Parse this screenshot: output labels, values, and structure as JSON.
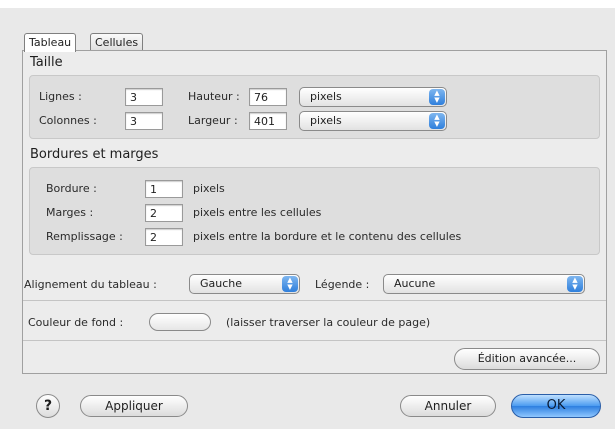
{
  "tabs": [
    {
      "label": "Tableau",
      "active": true
    },
    {
      "label": "Cellules",
      "active": false
    }
  ],
  "size_section": {
    "title": "Taille",
    "rows_label": "Lignes :",
    "rows_value": "3",
    "columns_label": "Colonnes :",
    "columns_value": "3",
    "height_label": "Hauteur :",
    "height_value": "76",
    "height_unit": "pixels",
    "width_label": "Largeur :",
    "width_value": "401",
    "width_unit": "pixels"
  },
  "borders_section": {
    "title": "Bordures et marges",
    "border_label": "Bordure :",
    "border_value": "1",
    "border_hint": "pixels",
    "spacing_label": "Marges :",
    "spacing_value": "2",
    "spacing_hint": "pixels entre les cellules",
    "padding_label": "Remplissage :",
    "padding_value": "2",
    "padding_hint": "pixels entre la bordure et le contenu des cellules"
  },
  "alignment": {
    "label": "Alignement du tableau :",
    "value": "Gauche",
    "caption_label": "Légende :",
    "caption_value": "Aucune"
  },
  "background": {
    "label": "Couleur de fond :",
    "hint": "(laisser traverser la couleur de page)"
  },
  "buttons": {
    "advanced": "Édition avancée...",
    "help": "?",
    "apply": "Appliquer",
    "cancel": "Annuler",
    "ok": "OK"
  },
  "colors": {
    "accent": "#3a8ae6",
    "window_bg": "#e9e9e9"
  }
}
